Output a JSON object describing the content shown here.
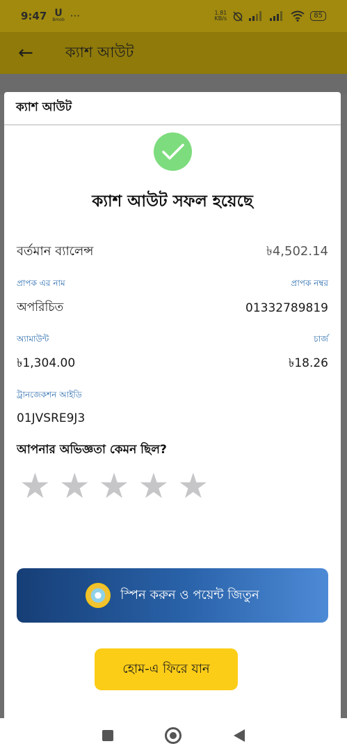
{
  "status_bar": {
    "time": "9:47",
    "notification_glyph": "U",
    "notification_sub": "Bmob",
    "more": "···",
    "speed_value": "1.81",
    "speed_unit": "KB/s",
    "battery": "85"
  },
  "app_bar": {
    "title": "ক্যাশ আউট"
  },
  "sheet": {
    "header": "ক্যাশ আউট",
    "success_title": "ক্যাশ আউট সফল হয়েছে",
    "balance_label": "বর্তমান ব্যালেন্স",
    "balance_value": "৳4,502.14",
    "receiver_name_label": "প্রাপক এর নাম",
    "receiver_number_label": "প্রাপক নম্বর",
    "receiver_name": "অপরিচিত",
    "receiver_number": "01332789819",
    "amount_label": "অ্যামাউন্ট",
    "charge_label": "চার্জ",
    "amount": "৳1,304.00",
    "charge": "৳18.26",
    "txn_label": "ট্রানজেকশন আইডি",
    "txn_id": "01JVSRE9J3",
    "feedback_question": "আপনার অভিজ্ঞতা কেমন ছিল?",
    "rating": 0,
    "rating_max": 5,
    "spin_button": "স্পিন করুন ও পয়েন্ট জিতুন",
    "home_button": "হোম-এ ফিরে যান"
  },
  "colors": {
    "success": "#7ddc7d",
    "label_blue": "#2f6fb0",
    "home_button": "#fccd17",
    "spin_gradient_start": "#163e76",
    "spin_gradient_end": "#4d8ad6",
    "star_inactive": "#c6c6c9"
  },
  "icons": {
    "back": "arrow-left-icon",
    "success": "check-circle-icon",
    "star": "star-icon",
    "spin": "spin-wheel-icon"
  }
}
